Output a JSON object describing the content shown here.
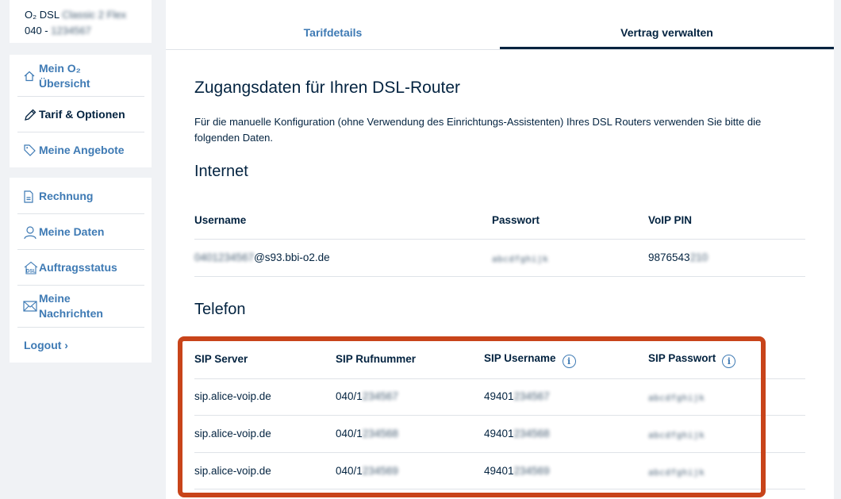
{
  "sidebar": {
    "account": {
      "line1_prefix": "O₂ DSL",
      "line1_masked": "Classic 2 Flex",
      "line2_prefix": "040 -",
      "line2_masked": "1234567"
    },
    "nav_primary": [
      {
        "label_line1": "Mein O₂",
        "label_line2": "Übersicht",
        "icon": "home-icon"
      },
      {
        "label": "Tarif & Optionen",
        "icon": "pencil-icon"
      },
      {
        "label": "Meine Angebote",
        "icon": "tag-icon"
      }
    ],
    "nav_secondary": [
      {
        "label": "Rechnung",
        "icon": "document-icon"
      },
      {
        "label": "Meine Daten",
        "icon": "user-icon"
      },
      {
        "label": "Auftragsstatus",
        "icon": "dsl-house-icon",
        "icon_text": "DSL"
      },
      {
        "label_line1": "Meine",
        "label_line2": "Nachrichten",
        "icon": "envelope-icon"
      }
    ],
    "logout": "Logout ›"
  },
  "tabs": [
    {
      "label": "Tarifdetails",
      "active": false
    },
    {
      "label": "Vertrag verwalten",
      "active": true
    }
  ],
  "content": {
    "title": "Zugangsdaten für Ihren DSL-Router",
    "description": "Für die manuelle Konfiguration (ohne Verwendung des Einrichtungs-Assistenten) Ihres DSL Routers verwenden Sie bitte die folgenden Daten.",
    "internet": {
      "heading": "Internet",
      "headers": [
        "Username",
        "Passwort",
        "VoIP PIN"
      ],
      "row": {
        "username_masked": "0401234567",
        "username_suffix": "@s93.bbi-o2.de",
        "password_masked": "abcdfghijk",
        "pin_prefix": "9876543",
        "pin_masked": "210"
      }
    },
    "telefon": {
      "heading": "Telefon",
      "headers": [
        "SIP Server",
        "SIP Rufnummer",
        "SIP Username",
        "SIP Passwort"
      ],
      "rows": [
        {
          "server": "sip.alice-voip.de",
          "number_prefix": "040/1",
          "number_masked": "234567",
          "user_prefix": "49401",
          "user_masked": "234567",
          "password_masked": "abcdfghijk"
        },
        {
          "server": "sip.alice-voip.de",
          "number_prefix": "040/1",
          "number_masked": "234568",
          "user_prefix": "49401",
          "user_masked": "234568",
          "password_masked": "abcdfghijk"
        },
        {
          "server": "sip.alice-voip.de",
          "number_prefix": "040/1",
          "number_masked": "234569",
          "user_prefix": "49401",
          "user_masked": "234569",
          "password_masked": "abcdfghijk"
        }
      ]
    }
  },
  "colors": {
    "accent": "#3e7ab4",
    "text": "#032340",
    "highlight": "#c8441a"
  }
}
